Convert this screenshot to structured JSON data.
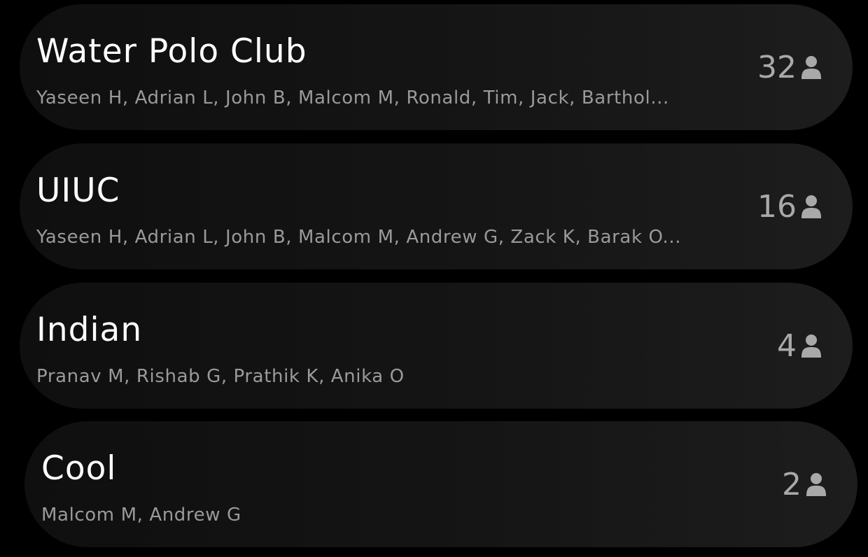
{
  "groups": [
    {
      "name": "Water Polo Club",
      "members": "Yaseen H, Adrian L, John B, Malcom M, Ronald, Tim, Jack, Barthol...",
      "count": "32",
      "icon": "person-icon"
    },
    {
      "name": "UIUC",
      "members": "Yaseen H, Adrian L, John B, Malcom M, Andrew G, Zack K, Barak O...",
      "count": "16",
      "icon": "person-icon"
    },
    {
      "name": "Indian",
      "members": "Pranav M, Rishab G, Prathik K, Anika O",
      "count": "4",
      "icon": "person-icon"
    },
    {
      "name": "Cool",
      "members": "Malcom M, Andrew G",
      "count": "2",
      "icon": "person-icon"
    }
  ],
  "colors": {
    "background": "#000000",
    "card": "#151515",
    "title": "#ffffff",
    "members": "#9a9a9a",
    "count": "#a9a9a9"
  }
}
